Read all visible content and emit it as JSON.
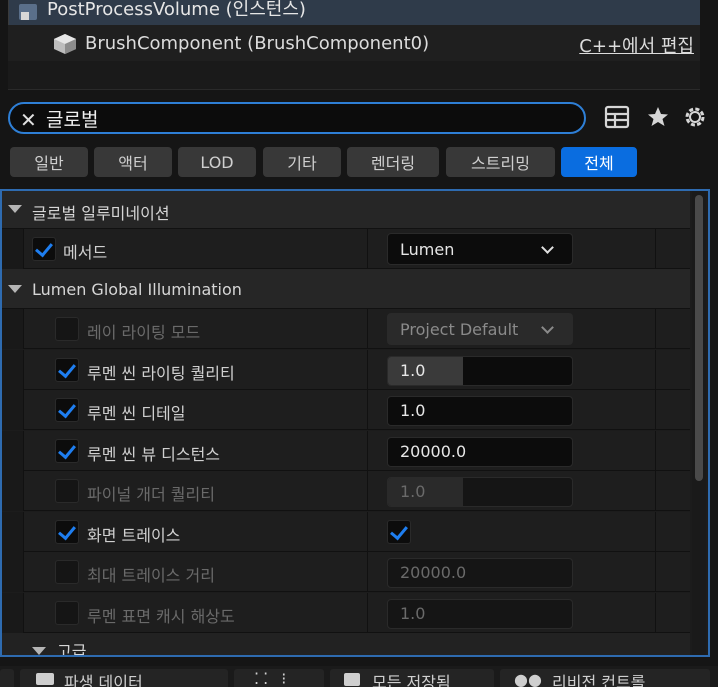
{
  "outliner": {
    "selected_row_label": "PostProcessVolume (인스턴스)",
    "component_row_label": "BrushComponent (BrushComponent0)",
    "cpp_edit_link": "C++에서 편집"
  },
  "search": {
    "value": "글로벌",
    "clear_icon": "close-icon"
  },
  "toolbar": {
    "table_icon": "table-view-icon",
    "star_icon": "star-icon",
    "settings_icon": "gear-icon"
  },
  "filter_tabs": [
    "일반",
    "액터",
    "LOD",
    "기타",
    "렌더링",
    "스트리밍",
    "전체"
  ],
  "active_tab": "전체",
  "details": {
    "category_gi": "글로벌 일루미네이션",
    "method_label": "메서드",
    "method_value": "Lumen",
    "category_lumen": "Lumen Global Illumination",
    "properties": [
      {
        "label": "레이 라이팅 모드",
        "value": "Project Default",
        "enabled": false,
        "checked": false
      },
      {
        "label": "루멘 씬 라이팅 퀄리티",
        "value": "1.0",
        "enabled": true,
        "checked": true
      },
      {
        "label": "루멘 씬 디테일",
        "value": "1.0",
        "enabled": true,
        "checked": true
      },
      {
        "label": "루멘 씬 뷰 디스턴스",
        "value": "20000.0",
        "enabled": true,
        "checked": true
      },
      {
        "label": "파이널 개더 퀄리티",
        "value": "1.0",
        "enabled": false,
        "checked": false
      },
      {
        "label": "화면 트레이스",
        "value": "",
        "enabled": true,
        "checked": true,
        "value_checked": true
      },
      {
        "label": "최대 트레이스 거리",
        "value": "20000.0",
        "enabled": false,
        "checked": false
      },
      {
        "label": "루멘 표면 캐시 해상도",
        "value": "1.0",
        "enabled": false,
        "checked": false
      }
    ],
    "category_advanced": "고급"
  },
  "bottom_tabs": [
    "파생 데이터",
    "모든 저장됨",
    "리비전 컨트롤"
  ],
  "colors": {
    "accent": "#0a6de0",
    "focus_border": "#2e7fd6",
    "check": "#1e7ef0"
  }
}
